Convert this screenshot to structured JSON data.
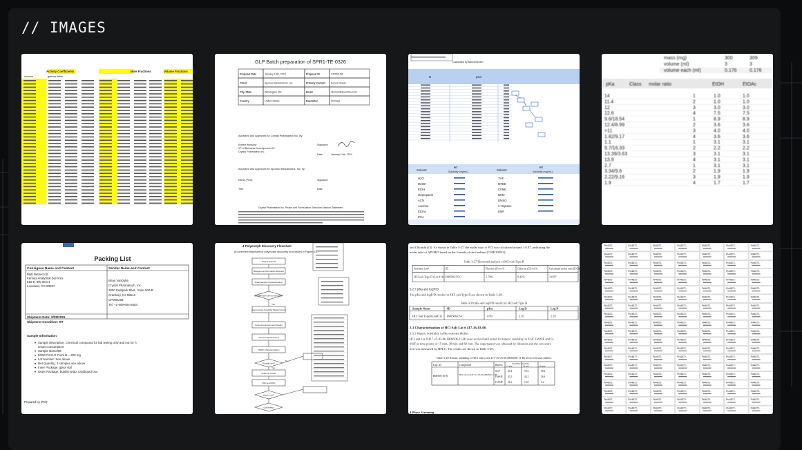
{
  "page": {
    "heading": "// IMAGES"
  },
  "images": [
    {
      "kind": "spreadsheet-highlighted",
      "header_a": "Activity Coefficients",
      "header_b": "Mole Fractions",
      "header_c": "Volume Fractions",
      "sub_a": "Acetone",
      "sub_b": "gamma Water"
    },
    {
      "kind": "document",
      "title": "GLP Batch preparation of SPR1-TE-0326",
      "rows": [
        [
          "Proposal Date",
          "January 14th, 2024",
          "Proposal ID",
          "CP052U08"
        ],
        [
          "Client",
          "Sponsor Biosolutions, Inc.",
          "Primary Contact",
          "Kenes Nnedo"
        ],
        [
          "City, State",
          "Wilmington, DE",
          "Email",
          "rdnmes@sponsbio.com"
        ],
        [
          "Country",
          "United States",
          "Expiration",
          "90 Days"
        ]
      ],
      "accepted_by": "Accepted and Approved for Crystal Pharmatech Inc. by:",
      "signer_name": "Robert Wenslow",
      "signer_title": "VP of Business Development US",
      "signer_org": "Crystal Pharmatech Inc.",
      "signature_label": "Signature:",
      "date_label": "Date:",
      "date_value": "January 14th, 2024",
      "accepted_by_2": "Accepted and Approved for Sponsor Biosolutions, Inc. by:",
      "name_label": "Name (Print):",
      "title_label": "Title:",
      "footer_title": "Crystal Pharmatech Inc. Phase and Formulation Selection Mission Statement"
    },
    {
      "kind": "table-blue",
      "header_note": "Calculated by MarvinSketch",
      "col_n": "N",
      "col_pka": "pKa",
      "col_solv": "Solvent",
      "col_rt": "RT",
      "col_sol": "Solubility (mg/mL)",
      "solvents_left": [
        "H2O",
        "MeOH",
        "EtOH",
        "Isopropanol",
        "ACN",
        "Acetone",
        "EtOAc",
        "IPAc"
      ],
      "solvents_right": [
        "THF",
        "MTBE",
        "CPME",
        "DCM",
        "DMSO",
        "n-Heptane",
        "DMF"
      ]
    },
    {
      "kind": "table-blurred",
      "rows_top": [
        [
          "mass (mg)",
          "300",
          "309"
        ],
        [
          "volume (ml)",
          "3",
          "3"
        ],
        [
          "volume each (ml)",
          "0.176",
          "0.176"
        ]
      ],
      "headers": [
        "pKa",
        "Class",
        "molar ratio",
        "EtOH",
        "EtOAc"
      ],
      "left_values": [
        "14",
        "11.4",
        "12",
        "12.6",
        "9.6/18.54",
        "12.4/8.99",
        ">11",
        "1.82/9.17",
        "1.1",
        "9.7/16.33",
        "13.39/3.63",
        "13.9",
        "2.7",
        "3.34/9.6",
        "2.22/9.16",
        "1.9"
      ],
      "right_values": [
        "1.0",
        "1.0",
        "3.0",
        "7.5",
        "8.9",
        "3.6",
        "4.0",
        "3.6",
        "3.1",
        "2.2",
        "3.1",
        "3.1",
        "3.1",
        "1.9",
        "1.9",
        "1.7"
      ]
    },
    {
      "kind": "packing-list",
      "title": "Packing List",
      "consignee_header": "Consignee Name and Contact",
      "sender_header": "Sender Name and Contact",
      "consignee": [
        "Matt Nethercott",
        "Kansas Analytical Services",
        "510 E. 5th Street",
        "Loveland, CO 80537"
      ],
      "sender": [
        "Brian VanDyke",
        "Crystal Pharmatech, Inc.",
        "3000 Eastpark Blvd., Suite 500-B",
        "Cranbury, NJ 08512",
        "CP005U08",
        "Tel: +1-609-604-8303"
      ],
      "shipment_date": "Shipment Date: 2/28/2025",
      "shipment_condition": "Shipment Condition: RT",
      "sample_info_title": "Sample Information",
      "bullets": [
        "Sample description: Chemical compound for lab testing only and not for human consumption.",
        "Sample Name/ID:",
        "50/50 Form E Form B ~ 200 mg",
        "Lot Number: See above",
        "Net Quantity: 3 samples see above",
        "Inner Package: glass vial",
        "Outer Package: bubble wrap, cardboard box"
      ],
      "prepared_by": "Prepared by (PM):"
    },
    {
      "kind": "flowchart",
      "section": "4   Polymorph Discovery Flowchart",
      "intro": "An overview flowchart for polymorph discovery is provided in Figure 4-1.",
      "nodes": [
        "Project Kick-off",
        "Background Information Request",
        "Initial Sample Characterization",
        "Excellent with client's information",
        "Approximate Solubility Measurement",
        "Screening Experiment Design",
        "Performing Screening",
        "XRPD Characterization",
        "Possible Hits?",
        "Scale-up of Hits",
        "DSC and DSC",
        "Weight loss?",
        "Optimization"
      ],
      "yes": "Yes",
      "no": "No"
    },
    {
      "kind": "report",
      "p1": "and Chloride (Cl). As shown in Table 3-27, the molar ratio of FCI was calculated around 1:0.87, indicating the molar ratio of API/HCl based on the formula of the freebase (C20H19FN4).",
      "t1_caption": "Table 3-27 Elemental analysis of HCl salt Type B",
      "t1_headers": [
        "Freebase Lot#",
        "ID",
        "Fluorine (F) wt %",
        "Chlorine (Cl) wt %",
        "Calculated molar ratio (F:Cl)"
      ],
      "t1_row": [
        "HCl salt Type B (Lot #11)",
        "B00506-05-C",
        "5.78%",
        "9.43%",
        "1:0.87"
      ],
      "s327": "3.2.7  pKa and logP/D",
      "p2": "The pKa and logP/D results for HCl salt Type B are shown in Table 3-28.",
      "t2_caption": "Table 3-28 pKa and logP/D results for HCl salt Type B",
      "t2_headers": [
        "Sample Name",
        "ID",
        "pKa",
        "Log D",
        "Log P"
      ],
      "t2_row": [
        "HCl Salt TypeB (lot#11)",
        "B00506-05-C",
        "4.99",
        "2.95",
        "2.95"
      ],
      "s33": "3.3  Characterization of HCl Salt Lot # 417-16-03-06",
      "s331": "3.3.1  Kinetic Solubility in Bio-relevant Buffer",
      "p3": "HCl salt Lot # 417-15-03-06 (B00506-11-B) was received and tested for kinetic solubility in SGF, FaSSIF and FeSSIF at time points of 15 min, 30 min and 60 min. The supernatant was obtained by filtration and the concentration was measured by HPLC. The results are shown in Table 3-29.",
      "t3_caption": "Table 3-29 Kinetic solubility of HCl salt Lot # 417-15-03-06 (B00506-11-B) in bio-relevant buffers",
      "t3_headers": [
        "Exp. ID",
        "Compound",
        "Buffers",
        "Solubility (mg/mL)",
        "15 min",
        "30 min",
        "60 min"
      ],
      "t3_exp": "B00506-16-B",
      "t3_comp": "HCl salt lot #417-15-03-06 (B00506-11-B)",
      "t3_rows": [
        [
          "SGF",
          "49.4",
          "50.2",
          "50.4"
        ],
        [
          "FaSSIF",
          "43.5",
          "44.3",
          "56.8"
        ],
        [
          "FeSSIF",
          "31.6",
          "10.0",
          "3.2"
        ]
      ],
      "s4": "4   Phase Screening"
    },
    {
      "kind": "label-grid",
      "prefix": "Ft44872-"
    }
  ]
}
